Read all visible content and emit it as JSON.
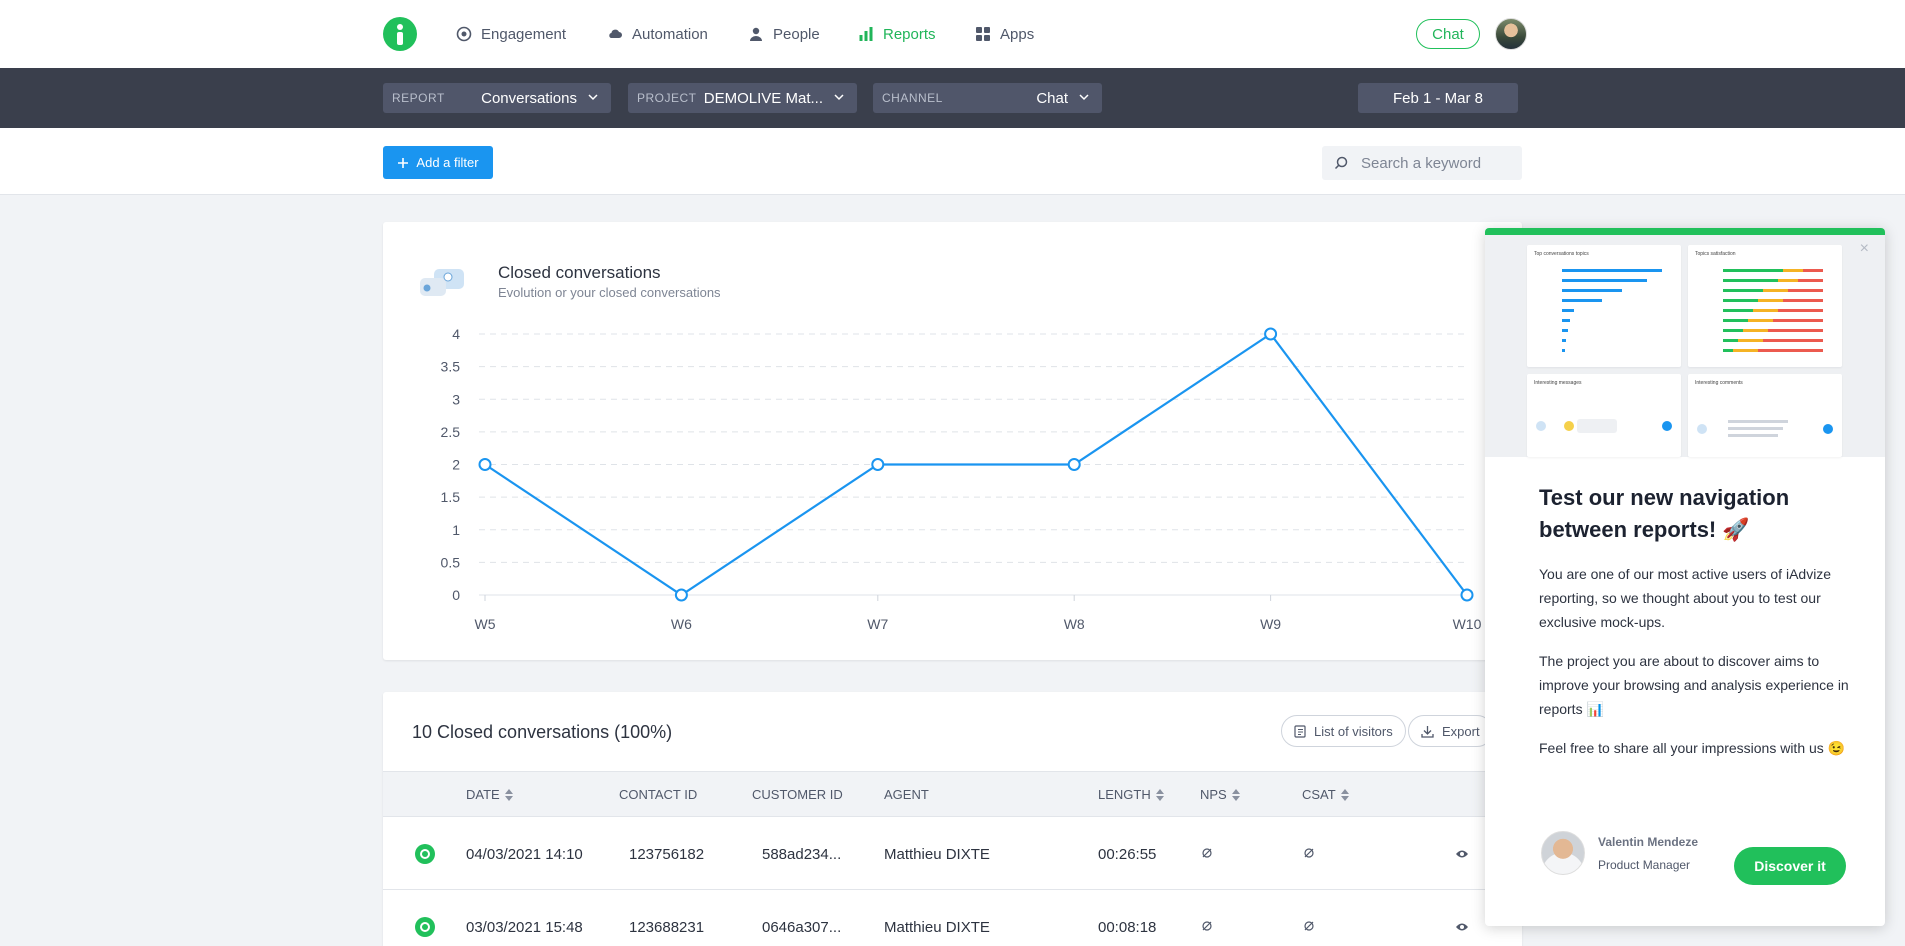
{
  "nav": {
    "items": [
      {
        "label": "Engagement",
        "icon": "target-icon",
        "active": false
      },
      {
        "label": "Automation",
        "icon": "cloud-icon",
        "active": false
      },
      {
        "label": "People",
        "icon": "person-icon",
        "active": false
      },
      {
        "label": "Reports",
        "icon": "bar-chart-icon",
        "active": true
      },
      {
        "label": "Apps",
        "icon": "grid-icon",
        "active": false
      }
    ],
    "chat_label": "Chat",
    "accent_color": "#21c05b"
  },
  "filters": {
    "report": {
      "label": "REPORT",
      "value": "Conversations"
    },
    "project": {
      "label": "PROJECT",
      "value": "DEMOLIVE Mat..."
    },
    "channel": {
      "label": "CHANNEL",
      "value": "Chat"
    },
    "date_range": "Feb 1 - Mar 8"
  },
  "actions": {
    "add_filter_label": "Add a filter",
    "search_placeholder": "Search a keyword"
  },
  "chart_card": {
    "title": "Closed conversations",
    "subtitle": "Evolution or your closed conversations"
  },
  "chart_data": {
    "type": "line",
    "title": "Closed conversations",
    "subtitle": "Evolution or your closed conversations",
    "categories": [
      "W5",
      "W6",
      "W7",
      "W8",
      "W9",
      "W10"
    ],
    "series": [
      {
        "values": [
          2,
          0,
          2,
          2,
          4,
          0
        ],
        "color": "#1a95f0"
      }
    ],
    "ylim": [
      0,
      4
    ],
    "yticks": [
      "0",
      "0.5",
      "1",
      "1.5",
      "2",
      "2.5",
      "3",
      "3.5",
      "4"
    ],
    "grid": true,
    "legend": "none"
  },
  "table": {
    "title": "10 Closed conversations (100%)",
    "list_visitors_label": "List of visitors",
    "export_label": "Export",
    "columns": [
      "DATE",
      "CONTACT ID",
      "CUSTOMER ID",
      "AGENT",
      "LENGTH",
      "NPS",
      "CSAT"
    ],
    "rows": [
      {
        "date": "04/03/2021 14:10",
        "contact_id": "123756182",
        "customer_id": "588ad234...",
        "agent": "Matthieu DIXTE",
        "length": "00:26:55"
      },
      {
        "date": "03/03/2021 15:48",
        "contact_id": "123688231",
        "customer_id": "0646a307...",
        "agent": "Matthieu DIXTE",
        "length": "00:08:18"
      }
    ]
  },
  "popup": {
    "title": "Test our new navigation between reports! 🚀",
    "p1": "You are one of our most active users of iAdvize reporting, so we thought about you to test our exclusive mock-ups.",
    "p2": "The project you are about to discover aims to improve your browsing and analysis experience in reports 📊",
    "p3": "Feel free to share all your impressions with us 😉",
    "close_label": "×",
    "author_name": "Valentin Mendeze",
    "author_role": "Product Manager",
    "cta_label": "Discover it",
    "mockups": [
      {
        "title": "Top conversations topics"
      },
      {
        "title": "Topics satisfaction"
      },
      {
        "title": "Interesting messages"
      },
      {
        "title": "Interesting comments"
      }
    ]
  }
}
